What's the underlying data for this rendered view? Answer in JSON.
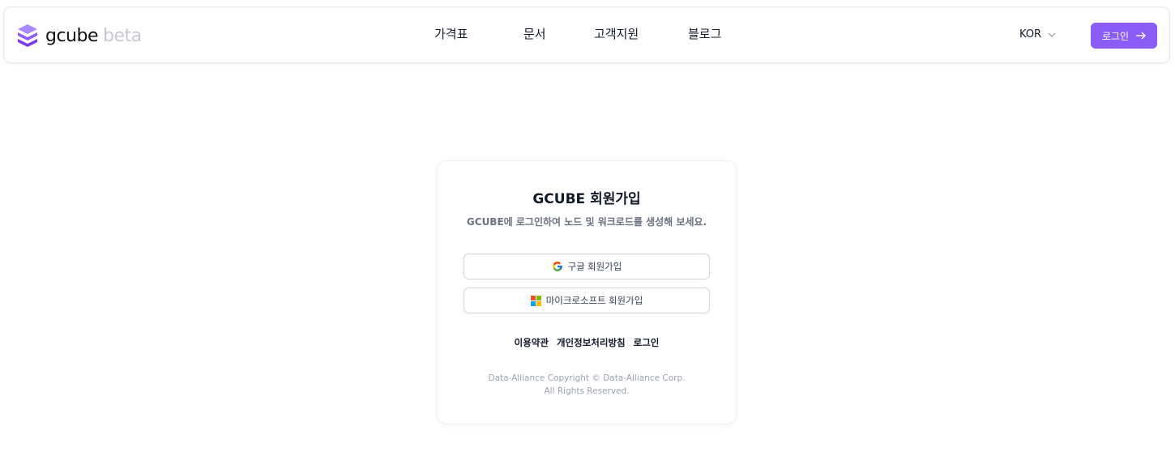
{
  "header": {
    "logo_name": "gcube",
    "logo_badge": "beta",
    "nav": [
      "가격표",
      "문서",
      "고객지원",
      "블로그"
    ],
    "language": "KOR",
    "login_label": "로그인"
  },
  "signup": {
    "title": "GCUBE 회원가입",
    "subtitle": "GCUBE에 로그인하여 노드 및 워크로드를 생성해 보세요.",
    "google_label": "구글 회원가입",
    "microsoft_label": "마이크로소프트 회원가입",
    "links": [
      "이용약관",
      "개인정보처리방침",
      "로그인"
    ],
    "copyright_line1": "Data-Alliance Copyright © Data-Alliance Corp.",
    "copyright_line2": "All Rights Reserved."
  },
  "colors": {
    "accent": "#8b5cf6"
  }
}
